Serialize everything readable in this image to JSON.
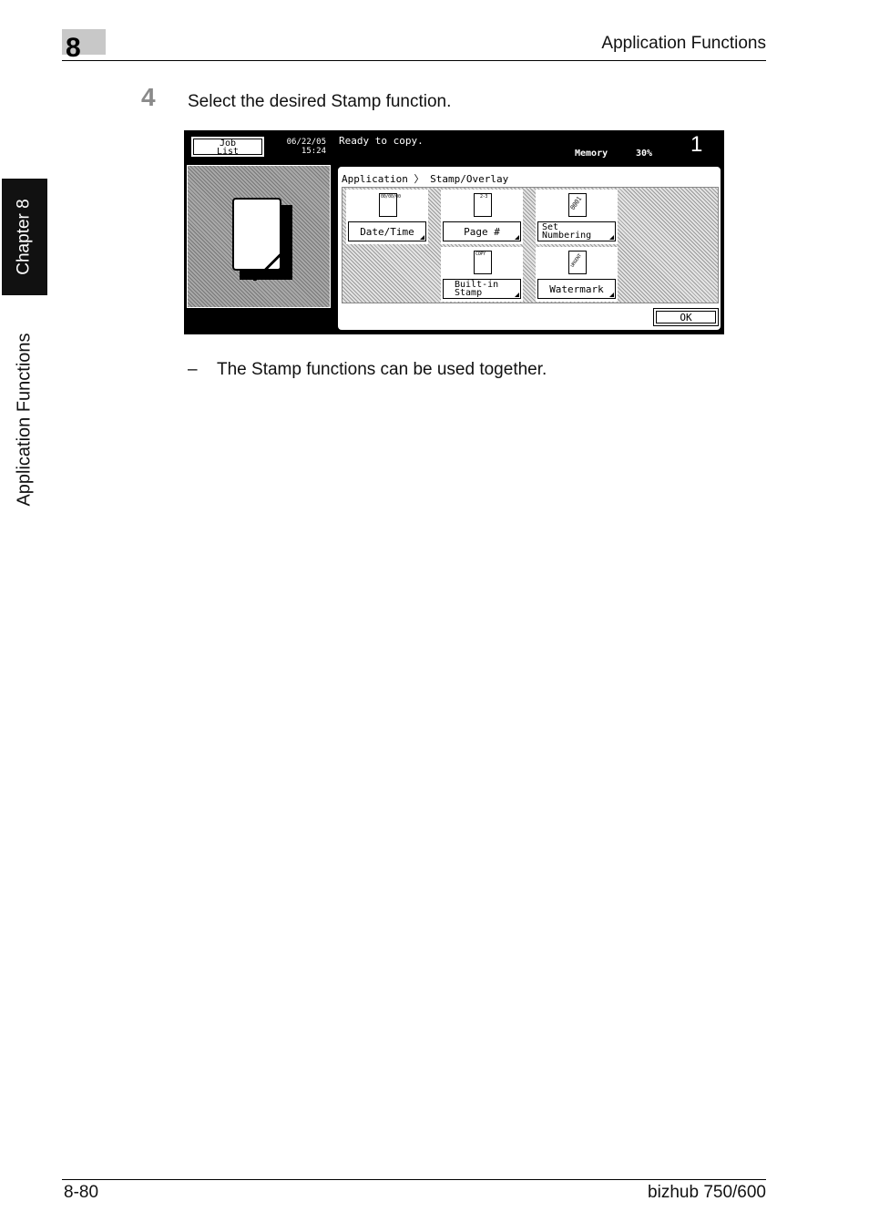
{
  "header": {
    "chapter_number": "8",
    "title": "Application Functions"
  },
  "side": {
    "chapter_tab": "Chapter 8",
    "section_label": "Application Functions"
  },
  "step": {
    "number": "4",
    "text": "Select the desired Stamp function."
  },
  "screen": {
    "job_list_button": "Job\nList",
    "date": "06/22/05",
    "time": "15:24",
    "status_message": "Ready to copy.",
    "memory_label": "Memory",
    "memory_value": "30%",
    "copies": "1",
    "breadcrumb": "Application 〉 Stamp/Overlay",
    "functions": [
      {
        "label": "Date/Time",
        "icon": "date-time-doc-icon",
        "icon_mark": "00/00/00"
      },
      {
        "label": "Page #",
        "icon": "page-number-doc-icon",
        "icon_mark": "2-3"
      },
      {
        "label": "Set\nNumbering",
        "icon": "set-numbering-doc-icon",
        "icon_mark": "0001"
      },
      {
        "label": "Built-in\nStamp",
        "icon": "built-in-stamp-doc-icon",
        "icon_mark": "COPY"
      },
      {
        "label": "Watermark",
        "icon": "watermark-doc-icon",
        "icon_mark": "URGENT"
      }
    ],
    "ok_button": "OK"
  },
  "note": {
    "dash": "–",
    "text": "The Stamp functions can be used together."
  },
  "footer": {
    "page": "8-80",
    "product": "bizhub 750/600"
  }
}
